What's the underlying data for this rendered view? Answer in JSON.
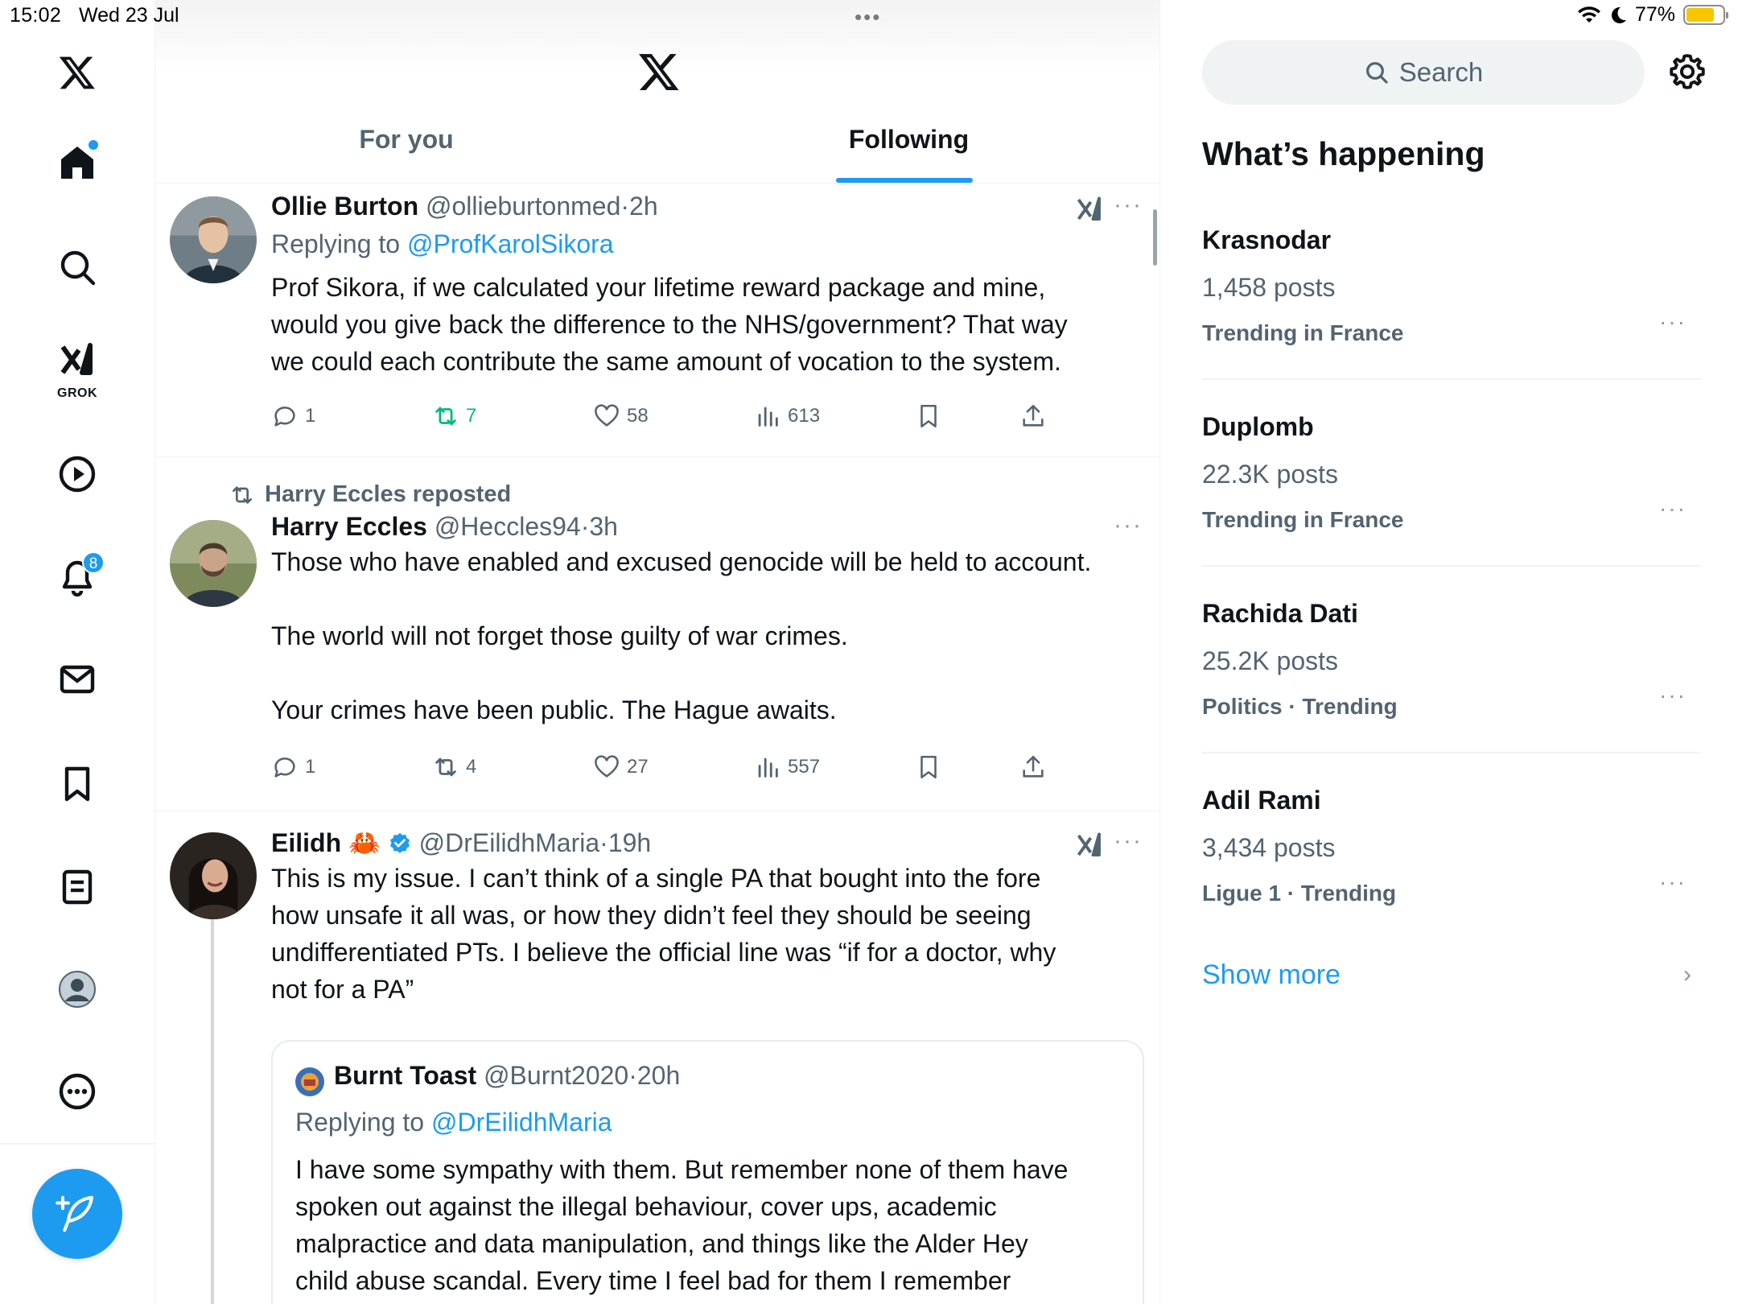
{
  "status_bar": {
    "time": "15:02",
    "date": "Wed 23 Jul",
    "battery": "77%",
    "battery_level": 0.77,
    "center_dots": "•••"
  },
  "nav": {
    "items": [
      "x-logo",
      "home",
      "search",
      "grok",
      "videos",
      "notifications",
      "messages",
      "bookmarks",
      "lists",
      "profile",
      "more"
    ],
    "grok_label": "GROK",
    "notifications_badge": "8"
  },
  "header": {
    "tabs": [
      {
        "label": "For you",
        "active": false
      },
      {
        "label": "Following",
        "active": true
      }
    ]
  },
  "posts": [
    {
      "name": "Ollie Burton",
      "handle": "@ollieburtonmed",
      "time": "2h",
      "replying_prefix": "Replying to ",
      "replying_to": "@ProfKarolSikora",
      "lines": [
        "Prof Sikora, if we calculated your lifetime reward package and mine,",
        "would you give back the difference to the NHS/government? That way",
        "we could each contribute the same amount of vocation to the system."
      ],
      "replies": "1",
      "reposts": "7",
      "likes": "58",
      "views": "613"
    },
    {
      "repost_by": "Harry Eccles reposted",
      "name": "Harry Eccles",
      "handle": "@Heccles94",
      "time": "3h",
      "lines": [
        "Those who have enabled and excused genocide will be held to account.",
        "",
        "The world will not forget those guilty of war crimes.",
        "",
        "Your crimes have been public. The Hague awaits."
      ],
      "replies": "1",
      "reposts": "4",
      "likes": "27",
      "views": "557"
    },
    {
      "name": "Eilidh",
      "emoji": "🦀",
      "handle": "@DrEilidhMaria",
      "time": "19h",
      "lines": [
        "This is my issue. I can’t think of a single PA that bought into the fore",
        "how unsafe it all was, or how they didn’t feel they should be seeing",
        "undifferentiated PTs. I believe the official line was “if for a doctor, why",
        "not for a PA”"
      ],
      "quote": {
        "name": "Burnt Toast",
        "handle": "@Burnt2020",
        "time": "20h",
        "replying_prefix": "Replying to ",
        "replying_to": "@DrEilidhMaria",
        "lines": [
          "I have some sympathy with them. But remember none of them have",
          "spoken out against the illegal behaviour, cover ups, academic",
          "malpractice and data manipulation, and things like the Alder Hey",
          "child abuse scandal. Every time I feel bad for them I remember"
        ]
      }
    }
  ],
  "sidebar": {
    "search_placeholder": "Search",
    "heading": "What’s happening",
    "trends": [
      {
        "name": "Krasnodar",
        "count": "1,458 posts",
        "category": "Trending in France"
      },
      {
        "name": "Duplomb",
        "count": "22.3K posts",
        "category": "Trending in France"
      },
      {
        "name": "Rachida Dati",
        "count": "25.2K posts",
        "category": "Politics · Trending"
      },
      {
        "name": "Adil Rami",
        "count": "3,434 posts",
        "category": "Ligue 1 · Trending"
      }
    ],
    "show_more": "Show more",
    "more_glyph": "···",
    "chevron": "›"
  },
  "colors": {
    "accent": "#1d9bf0",
    "repost_active": "#00ba7c",
    "secondary_text": "#536471"
  }
}
